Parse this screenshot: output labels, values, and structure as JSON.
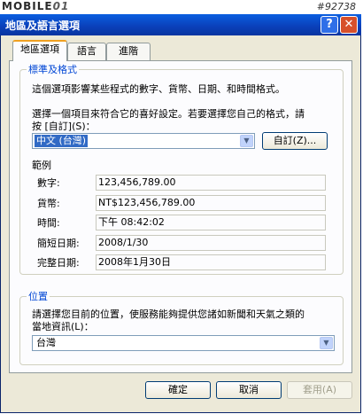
{
  "watermark": {
    "logo_left": "MOBILE",
    "logo_right": "01",
    "id": "#92738"
  },
  "window": {
    "title": "地區及語言選項",
    "help_glyph": "?",
    "close_glyph": "✕"
  },
  "tabs": [
    {
      "label": "地區選項"
    },
    {
      "label": "語言"
    },
    {
      "label": "進階"
    }
  ],
  "standards": {
    "group_title": "標準及格式",
    "description": "這個選項影響某些程式的數字、貨幣、日期、和時間格式。",
    "choose_line1": "選擇一個項目來符合它的喜好設定。若要選擇您自己的格式，請",
    "choose_line2": "按 [自訂](S)：",
    "format_selected": "中文 (台灣)",
    "customize_button": "自訂(Z)...",
    "samples_label": "範例",
    "samples": [
      {
        "label": "數字:",
        "value": "123,456,789.00"
      },
      {
        "label": "貨幣:",
        "value": "NT$123,456,789.00"
      },
      {
        "label": "時間:",
        "value": "下午 08:42:02"
      },
      {
        "label": "簡短日期:",
        "value": "2008/1/30"
      },
      {
        "label": "完整日期:",
        "value": "2008年1月30日"
      }
    ]
  },
  "location": {
    "group_title": "位置",
    "line1": "請選擇您目前的位置，使服務能夠提供您諸如新聞和天氣之類的",
    "line2": "當地資訊(L)：",
    "selected": "台灣"
  },
  "footer": {
    "ok": "確定",
    "cancel": "取消",
    "apply": "套用(A)"
  }
}
